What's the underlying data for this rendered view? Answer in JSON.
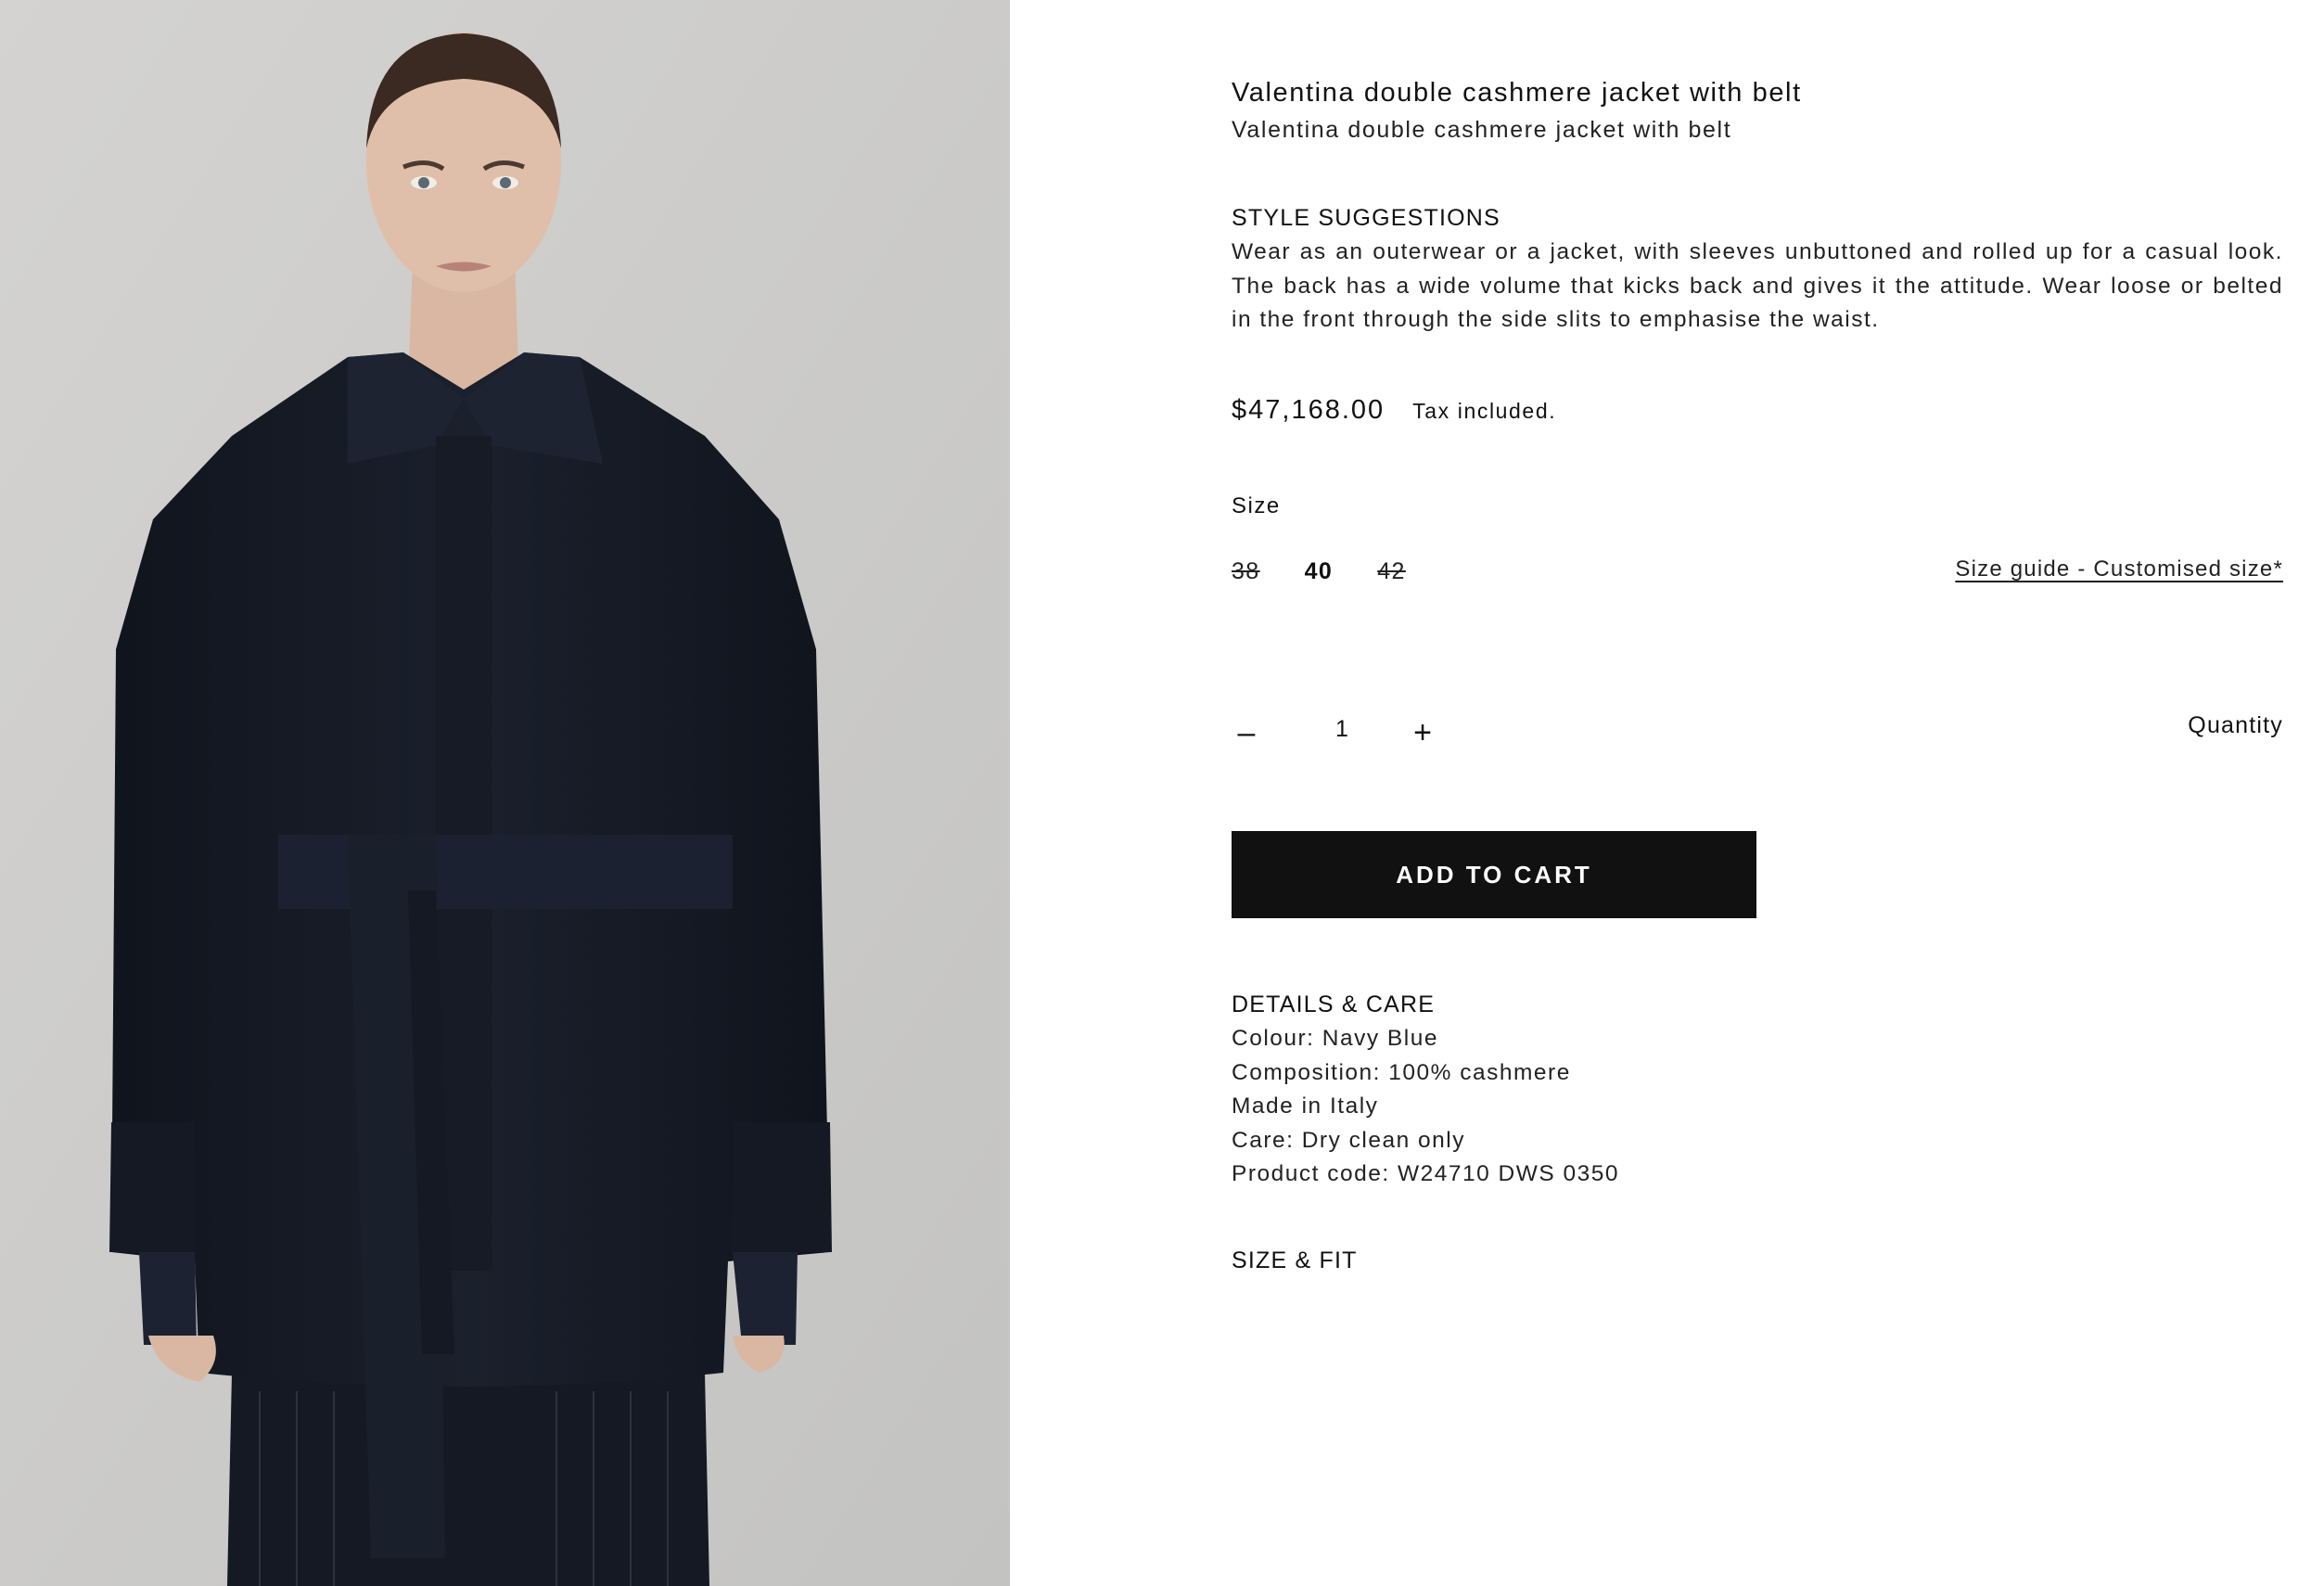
{
  "product": {
    "title": "Valentina double cashmere jacket with belt",
    "subtitle": "Valentina double cashmere jacket with belt",
    "image_alt": "Model wearing navy double cashmere jacket with belt",
    "price": "$47,168.00",
    "tax_note": "Tax included."
  },
  "style": {
    "heading": "STYLE SUGGESTIONS",
    "text": "Wear as an outerwear or a jacket, with sleeves unbuttoned and rolled up for a casual look. The back has a wide volume that kicks back and gives it the attitude. Wear loose or belted in the front through the side slits to emphasise the waist."
  },
  "size": {
    "label": "Size",
    "options": [
      {
        "label": "38",
        "state": "unavailable"
      },
      {
        "label": "40",
        "state": "selected"
      },
      {
        "label": "42",
        "state": "unavailable"
      }
    ],
    "guide_link": "Size guide - Customised size*"
  },
  "quantity": {
    "minus_symbol": "–",
    "value": "1",
    "plus_symbol": "+",
    "label": "Quantity"
  },
  "cart": {
    "button_label": "ADD TO CART",
    "button_color": "#111111"
  },
  "details": {
    "heading": "DETAILS & CARE",
    "items": [
      "Colour: Navy Blue",
      "Composition: 100% cashmere",
      "Made in Italy",
      "Care: Dry clean only",
      "Product code: W24710 DWS 0350"
    ]
  },
  "fit": {
    "heading": "SIZE & FIT"
  },
  "colors": {
    "background_left": "#cdcdcb",
    "jacket": "#161b26",
    "text": "#111111"
  }
}
